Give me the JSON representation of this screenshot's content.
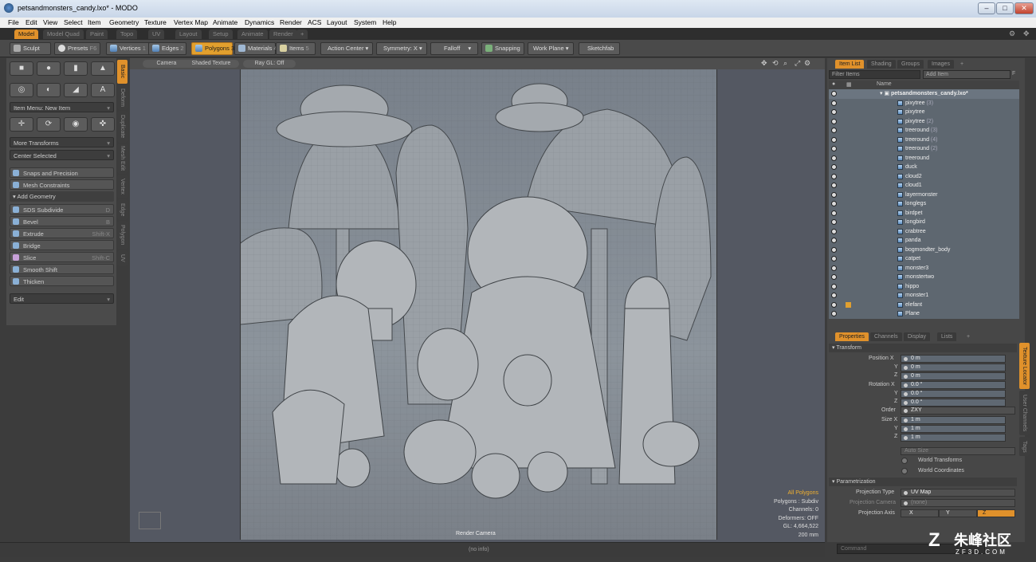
{
  "window": {
    "title": "petsandmonsters_candy.lxo* - MODO",
    "minimize": "–",
    "maximize": "□",
    "close": "✕"
  },
  "menu": [
    "File",
    "Edit",
    "View",
    "Select",
    "Item",
    "Geometry",
    "Texture",
    "Vertex Map",
    "Animate",
    "Dynamics",
    "Render",
    "ACS",
    "Layout",
    "System",
    "Help"
  ],
  "layout_tabs": [
    "Model",
    "Model Quad",
    "Paint",
    "Topo",
    "UV",
    "Layout",
    "Setup",
    "Animate",
    "Render",
    "+"
  ],
  "toolbar": {
    "sculpt": "Sculpt",
    "presets": "Presets",
    "presets_key": "F6",
    "vertices": "Vertices",
    "vertices_key": "1",
    "edges": "Edges",
    "edges_key": "2",
    "polygons": "Polygons",
    "polygons_key": "3",
    "materials": "Materials",
    "materials_key": "4",
    "items": "Items",
    "items_key": "5",
    "action_center": "Action Center",
    "symmetry": "Symmetry: X",
    "falloff": "Falloff",
    "snapping": "Snapping",
    "work_plane": "Work Plane",
    "sketchfab": "Sketchfab"
  },
  "left_panel": {
    "item_menu": "Item Menu: New Item",
    "more_transforms": "More Transforms",
    "center_selected": "Center Selected",
    "snaps": "Snaps and Precision",
    "mesh_constraints": "Mesh Constraints",
    "add_geometry": "Add Geometry",
    "tools": [
      {
        "label": "SDS Subdivide",
        "key": "D"
      },
      {
        "label": "Bevel",
        "key": "B"
      },
      {
        "label": "Extrude",
        "key": "Shift-X"
      },
      {
        "label": "Bridge",
        "key": ""
      },
      {
        "label": "Slice",
        "key": "Shift-C"
      },
      {
        "label": "Smooth Shift",
        "key": ""
      },
      {
        "label": "Thicken",
        "key": ""
      }
    ],
    "edit": "Edit",
    "side_tabs": [
      "Basic",
      "Deform",
      "Duplicate",
      "Mesh Edit",
      "Vertex",
      "Edge",
      "Polygon",
      "UV"
    ]
  },
  "viewport": {
    "camera": "Camera",
    "shading": "Shaded Texture",
    "raygl": "Ray GL: Off",
    "render_camera": "Render Camera",
    "info": [
      "All Polygons",
      "Polygons : Subdiv",
      "Channels: 0",
      "Deformers: OFF",
      "GL: 4,664,522",
      "200 mm"
    ],
    "status": "(no info)"
  },
  "item_panel": {
    "tabs": [
      "Item List",
      "Shading",
      "Groups",
      "Images",
      "+"
    ],
    "filter": "Filter Items",
    "add_item": "Add Item",
    "add_key": "F",
    "col_name": "Name",
    "scene": "petsandmonsters_candy.lxo*",
    "items": [
      {
        "name": "pixytree",
        "tag": "(3)"
      },
      {
        "name": "pixytree",
        "tag": ""
      },
      {
        "name": "pixytree",
        "tag": "(2)"
      },
      {
        "name": "treeround",
        "tag": "(3)"
      },
      {
        "name": "treeround",
        "tag": "(4)"
      },
      {
        "name": "treeround",
        "tag": "(2)"
      },
      {
        "name": "treeround",
        "tag": ""
      },
      {
        "name": "duck",
        "tag": ""
      },
      {
        "name": "cloud2",
        "tag": ""
      },
      {
        "name": "cloud1",
        "tag": ""
      },
      {
        "name": "layermonster",
        "tag": ""
      },
      {
        "name": "longlegs",
        "tag": ""
      },
      {
        "name": "birdpet",
        "tag": ""
      },
      {
        "name": "longbird",
        "tag": ""
      },
      {
        "name": "crabtree",
        "tag": ""
      },
      {
        "name": "panda",
        "tag": ""
      },
      {
        "name": "bogmondter_body",
        "tag": ""
      },
      {
        "name": "catpet",
        "tag": ""
      },
      {
        "name": "monster3",
        "tag": ""
      },
      {
        "name": "monstertwo",
        "tag": ""
      },
      {
        "name": "hippo",
        "tag": ""
      },
      {
        "name": "monster1",
        "tag": ""
      },
      {
        "name": "elefant",
        "tag": ""
      },
      {
        "name": "Plane",
        "tag": ""
      }
    ]
  },
  "properties": {
    "tabs": [
      "Properties",
      "Channels",
      "Display",
      "Lists",
      "+"
    ],
    "side_tabs": [
      "Texture Locator",
      "User Channels",
      "Tags"
    ],
    "transform": "Transform",
    "pos_label": "Position X",
    "rot_label": "Rotation X",
    "size_label": "Size X",
    "axis_y": "Y",
    "axis_z": "Z",
    "pos": [
      "0 m",
      "0 m",
      "0 m"
    ],
    "rot": [
      "0.0 °",
      "0.0 °",
      "0.0 °"
    ],
    "order_label": "Order",
    "order": "ZXY",
    "size": [
      "1 m",
      "1 m",
      "1 m"
    ],
    "auto_size": "Auto Size",
    "world_transforms": "World Transforms",
    "world_coords": "World Coordinates",
    "parametrization": "Parametrization",
    "proj_type_label": "Projection Type",
    "proj_type": "UV Map",
    "proj_cam_label": "Projection Camera",
    "proj_cam": "(none)",
    "proj_axis_label": "Projection Axis",
    "axes": [
      "X",
      "Y",
      "Z"
    ]
  },
  "command": "Command",
  "watermark": {
    "brand": "朱峰社区",
    "url": "ZF3D.COM"
  },
  "colors": {
    "accent": "#e0912b"
  }
}
